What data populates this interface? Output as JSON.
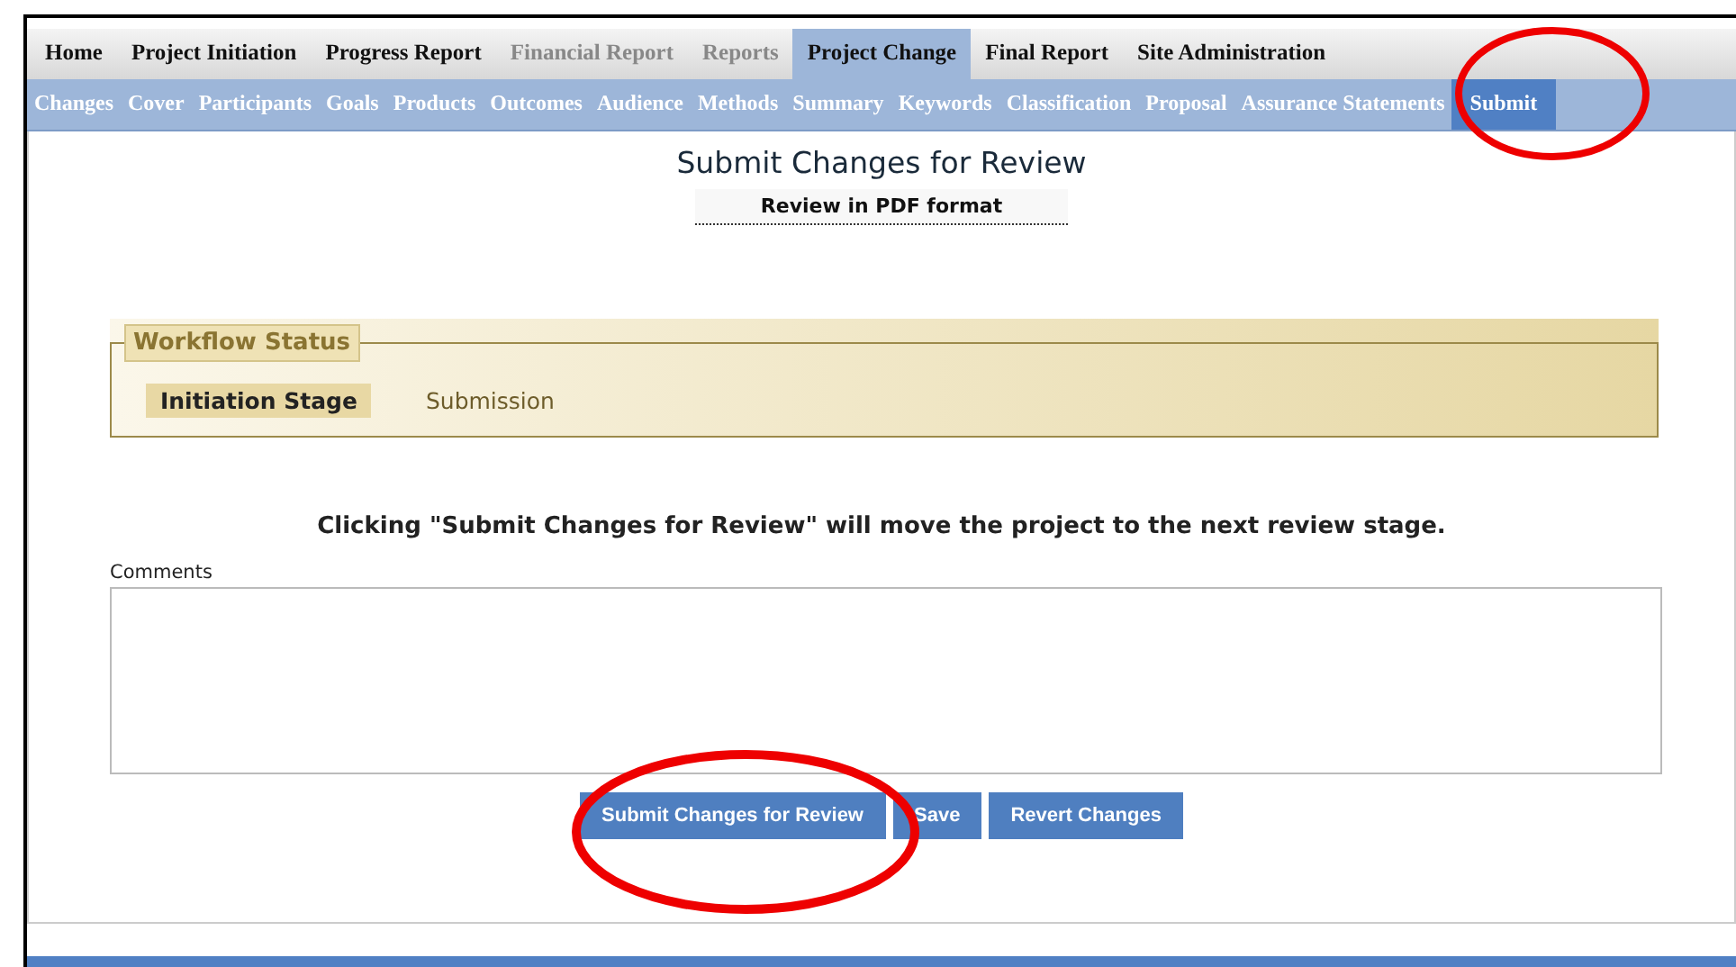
{
  "main_tabs": [
    {
      "label": "Home",
      "selected": false,
      "disabled": false
    },
    {
      "label": "Project Initiation",
      "selected": false,
      "disabled": false
    },
    {
      "label": "Progress Report",
      "selected": false,
      "disabled": false
    },
    {
      "label": "Financial Report",
      "selected": false,
      "disabled": true
    },
    {
      "label": "Reports",
      "selected": false,
      "disabled": true
    },
    {
      "label": "Project Change",
      "selected": true,
      "disabled": false
    },
    {
      "label": "Final Report",
      "selected": false,
      "disabled": false
    },
    {
      "label": "Site Administration",
      "selected": false,
      "disabled": false
    }
  ],
  "sub_tabs": [
    {
      "label": "Changes",
      "selected": false
    },
    {
      "label": "Cover",
      "selected": false
    },
    {
      "label": "Participants",
      "selected": false
    },
    {
      "label": "Goals",
      "selected": false
    },
    {
      "label": "Products",
      "selected": false
    },
    {
      "label": "Outcomes",
      "selected": false
    },
    {
      "label": "Audience",
      "selected": false
    },
    {
      "label": "Methods",
      "selected": false
    },
    {
      "label": "Summary",
      "selected": false
    },
    {
      "label": "Keywords",
      "selected": false
    },
    {
      "label": "Classification",
      "selected": false
    },
    {
      "label": "Proposal",
      "selected": false
    },
    {
      "label": "Assurance Statements",
      "selected": false
    },
    {
      "label": "Submit",
      "selected": true
    }
  ],
  "title": "Submit Changes for Review",
  "pdf_link": "Review in PDF format",
  "workflow": {
    "legend": "Workflow Status",
    "stages": [
      {
        "label": "Initiation Stage",
        "selected": true
      },
      {
        "label": "Submission",
        "selected": false
      }
    ]
  },
  "notice": "Clicking \"Submit Changes for Review\" will move the project to the next review stage.",
  "comments": {
    "label": "Comments"
  },
  "buttons": [
    "Submit Changes for Review",
    "Save",
    "Revert Changes"
  ]
}
